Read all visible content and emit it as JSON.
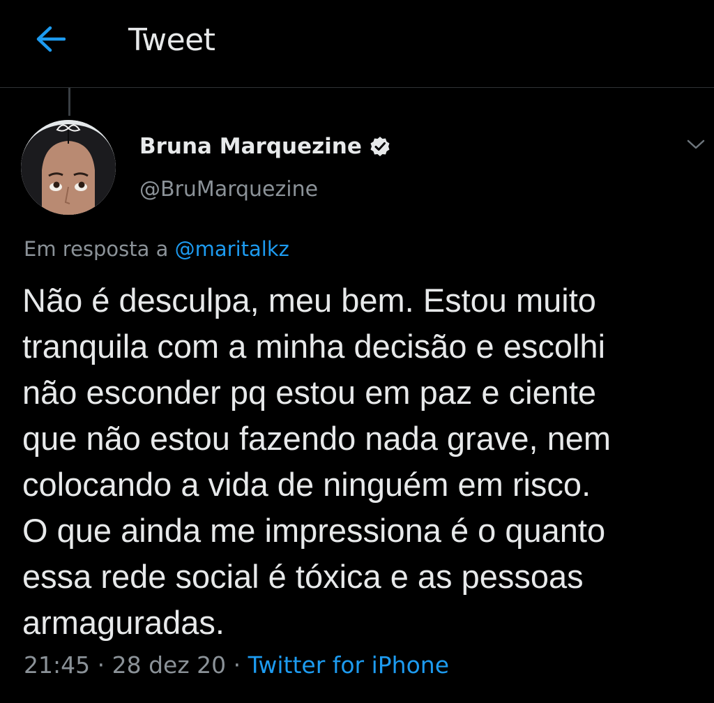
{
  "header": {
    "back_icon": "arrow-left-icon",
    "title": "Tweet"
  },
  "tweet": {
    "author": {
      "name": "Bruna Marquezine",
      "verified_icon": "verified-badge-icon",
      "handle": "@BruMarquezine"
    },
    "menu_icon": "chevron-down-icon",
    "reply_prefix": "Em resposta a",
    "reply_mention": "@maritalkz",
    "text": "Não é desculpa, meu bem. Estou muito\ntranquila com a minha decisão e escolhi\nnão esconder pq estou em paz e ciente\nque não estou fazendo nada grave, nem\ncolocando a vida de ninguém em risco.\nO que ainda me impressiona é o quanto\nessa rede social é tóxica e as pessoas\narmaguradas.",
    "time": "21:45",
    "separator": "·",
    "date": "28 dez 20",
    "source": "Twitter for iPhone"
  },
  "colors": {
    "background": "#000000",
    "primary_text": "#e7e9ea",
    "secondary_text": "#8b9298",
    "accent": "#1d9bf0"
  }
}
